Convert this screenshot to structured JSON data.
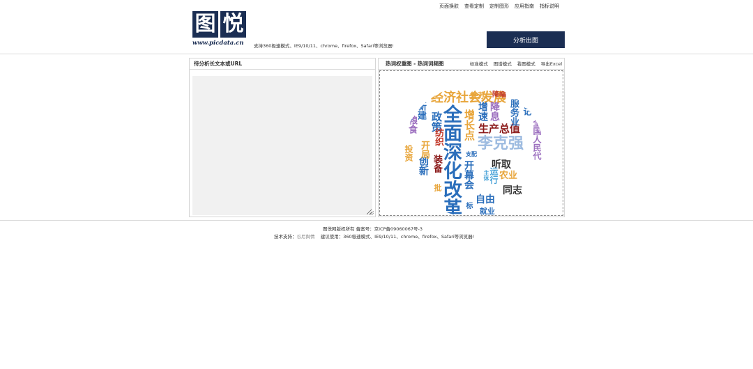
{
  "top_nav": [
    "页面换肤",
    "查看定制",
    "定制图形",
    "应用指南",
    "指标说明"
  ],
  "logo": {
    "text_1": "图",
    "text_2": "悦",
    "url": "www.picdata.cn"
  },
  "support_note": "支持360极速模式、IE9/10/11、chrome、firefox、Safari等浏览器!",
  "analyze_button": "分析出图",
  "left_panel": {
    "title": "待分析长文本或URL",
    "textarea_value": ""
  },
  "right_panel": {
    "title": "热词权重图 - 热词词频图",
    "modes": [
      "标准模式",
      "图谱模式",
      "看图模式",
      "导出Excel"
    ],
    "cloud_words": [
      {
        "text": "经济社会发展",
        "color": "#e8a53a"
      },
      {
        "text": "全面深化改革",
        "color": "#2a6ebb"
      },
      {
        "text": "李克强",
        "color": "#9dbbe0"
      },
      {
        "text": "生产总值",
        "color": "#8b1a1a"
      },
      {
        "text": "政策",
        "color": "#2a6ebb"
      },
      {
        "text": "增速",
        "color": "#2a6ebb"
      },
      {
        "text": "服务业",
        "color": "#2a6ebb"
      },
      {
        "text": "书记",
        "color": "#2a6ebb"
      },
      {
        "text": "降息",
        "color": "#9c6fbf"
      },
      {
        "text": "降幅",
        "color": "#c23a2b"
      },
      {
        "text": "复苏",
        "color": "#e8a53a"
      },
      {
        "text": "增长点",
        "color": "#e8a53a"
      },
      {
        "text": "听取",
        "color": "#333333"
      },
      {
        "text": "农业",
        "color": "#e8a53a"
      },
      {
        "text": "同志",
        "color": "#333333"
      },
      {
        "text": "自由",
        "color": "#2a6ebb"
      },
      {
        "text": "开幕会",
        "color": "#2a6ebb"
      },
      {
        "text": "运行",
        "color": "#4aa3d8"
      },
      {
        "text": "装备",
        "color": "#8b1a1a"
      },
      {
        "text": "创新",
        "color": "#2a6ebb"
      },
      {
        "text": "开局",
        "color": "#e8a53a"
      },
      {
        "text": "新建",
        "color": "#2a6ebb"
      },
      {
        "text": "纺织",
        "color": "#c23a2b"
      },
      {
        "text": "粮食",
        "color": "#9c6fbf"
      },
      {
        "text": "协",
        "color": "#2a6ebb"
      },
      {
        "text": "全国人民代",
        "color": "#9c6fbf"
      },
      {
        "text": "支配",
        "color": "#2a6ebb"
      },
      {
        "text": "就业",
        "color": "#2a6ebb"
      },
      {
        "text": "主体",
        "color": "#4aa3d8"
      },
      {
        "text": "投资",
        "color": "#e8a53a"
      },
      {
        "text": "标",
        "color": "#2a6ebb"
      },
      {
        "text": "批",
        "color": "#e8a53a"
      }
    ]
  },
  "footer": {
    "copyright": "图悦网版权所有 备案号：京ICP备09060067号-3",
    "tech_support_label": "技术支持：",
    "tech_support_link": "谷尼舆情",
    "browser_note": "建议使用：360极速模式、IE9/10/11、chrome、firefox、Safari等浏览器!"
  },
  "colors": {
    "brand_navy": "#1b2e53"
  }
}
